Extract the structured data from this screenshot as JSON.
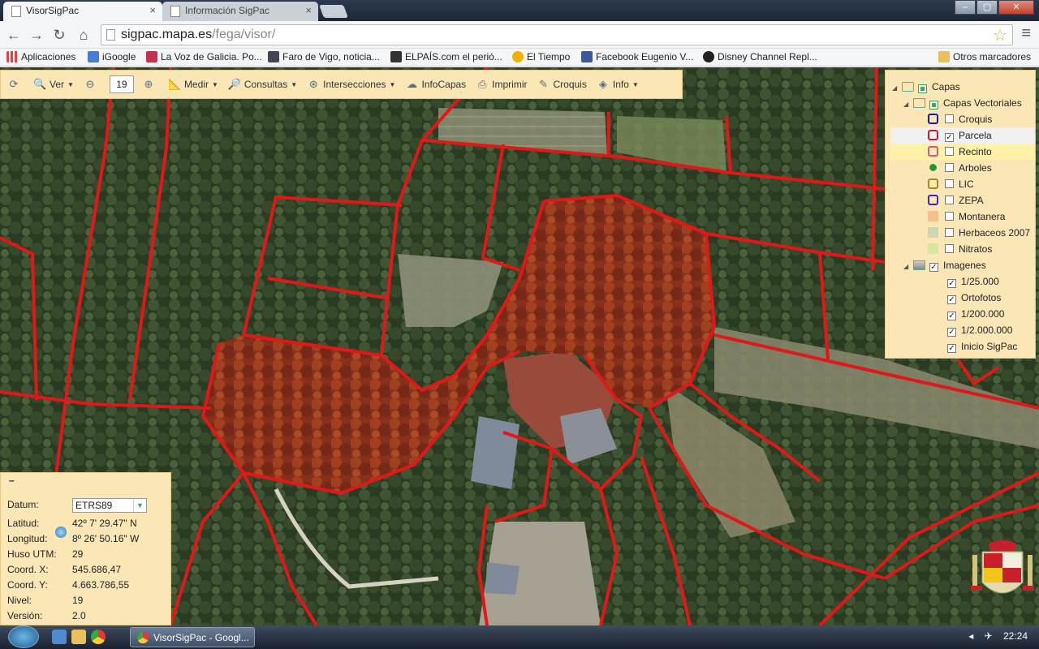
{
  "browser": {
    "tabs": [
      {
        "title": "VisorSigPac",
        "close": "×"
      },
      {
        "title": "Información SigPac",
        "close": "×"
      }
    ],
    "window_controls": {
      "minimize": "–",
      "maximize": "▢",
      "close": "✕"
    },
    "nav": {
      "back": "←",
      "forward": "→",
      "reload": "↻",
      "home": "⌂"
    },
    "url_host": "sigpac.mapa.es",
    "url_path": "/fega/visor/",
    "star": "☆",
    "menu": "≡",
    "bookmarks": [
      {
        "label": "Aplicaciones",
        "color": "#d44"
      },
      {
        "label": "iGoogle",
        "color": "#4a7ad8"
      },
      {
        "label": "La Voz de Galicia. Po...",
        "color": "#c2334b"
      },
      {
        "label": "Faro de Vigo, noticia...",
        "color": "#445"
      },
      {
        "label": "ELPAÍS.com el perió...",
        "color": "#333"
      },
      {
        "label": "El Tiempo",
        "color": "#f2b100"
      },
      {
        "label": "Facebook Eugenio V...",
        "color": "#3b5998"
      },
      {
        "label": "Disney Channel Repl...",
        "color": "#222"
      }
    ],
    "other_bookmarks": "Otros marcadores"
  },
  "toolbar": {
    "reload_icon": "⟳",
    "ver": "Ver",
    "zoom_value": "19",
    "medir": "Medir",
    "consultas": "Consultas",
    "intersecciones": "Intersecciones",
    "infocapas": "InfoCapas",
    "imprimir": "Imprimir",
    "croquis": "Croquis",
    "info": "Info"
  },
  "layers": {
    "root": "Capas",
    "vector_group": "Capas Vectoriales",
    "vector_items": [
      {
        "label": "Croquis",
        "checked": false,
        "swatch": "#1a1aa8",
        "type": "outline"
      },
      {
        "label": "Parcela",
        "checked": true,
        "swatch": "#c0202a",
        "type": "outline"
      },
      {
        "label": "Recinto",
        "checked": false,
        "swatch": "#d2559c",
        "type": "outline"
      },
      {
        "label": "Arboles",
        "checked": false,
        "swatch": "#1f9a2a",
        "type": "tree"
      },
      {
        "label": "LIC",
        "checked": false,
        "swatch": "#9a8f1a",
        "type": "outline"
      },
      {
        "label": "ZEPA",
        "checked": false,
        "swatch": "#3a2ab0",
        "type": "outline"
      },
      {
        "label": "Montanera",
        "checked": false,
        "swatch": "#f5c08e",
        "type": "fill"
      },
      {
        "label": "Herbaceos 2007",
        "checked": false,
        "swatch": "#cfd7b0",
        "type": "fill"
      },
      {
        "label": "Nitratos",
        "checked": false,
        "swatch": "#d8e6a0",
        "type": "fill"
      }
    ],
    "image_group": "Imagenes",
    "image_items": [
      {
        "label": "1/25.000",
        "checked": true
      },
      {
        "label": "Ortofotos",
        "checked": true
      },
      {
        "label": "1/200.000",
        "checked": true
      },
      {
        "label": "1/2.000.000",
        "checked": true
      },
      {
        "label": "Inicio SigPac",
        "checked": true
      }
    ]
  },
  "coords": {
    "collapse": "–",
    "datum_label": "Datum:",
    "datum_value": "ETRS89",
    "lat_label": "Latitud:",
    "lat_value": "42º 7' 29.47\" N",
    "lon_label": "Longitud:",
    "lon_value": "8º 26' 50.16\" W",
    "huso_label": "Huso UTM:",
    "huso_value": "29",
    "x_label": "Coord. X:",
    "x_value": "545.686,47",
    "y_label": "Coord. Y:",
    "y_value": "4.663.786,55",
    "nivel_label": "Nivel:",
    "nivel_value": "19",
    "version_label": "Versión:",
    "version_value": "2.0"
  },
  "taskbar": {
    "app_label": "VisorSigPac - Googl...",
    "time": "22:24",
    "tray_arrow": "◂"
  },
  "colors": {
    "panel_bg": "#fbe6b6",
    "parcel_line": "#e01818",
    "selected_fill": "#b5391f"
  }
}
